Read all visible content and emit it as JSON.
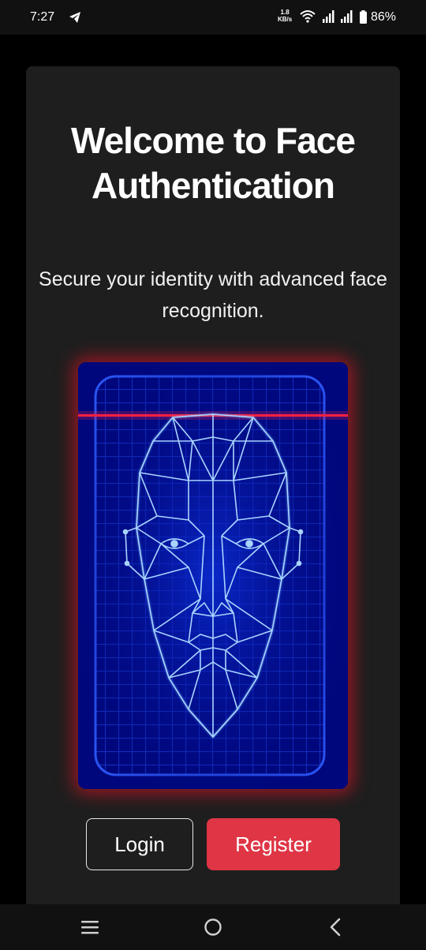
{
  "status_bar": {
    "time": "7:27",
    "speed_value": "1.8",
    "speed_unit": "KB/s",
    "battery": "86%",
    "icons": [
      "telegram-icon",
      "wifi-icon",
      "signal-icon",
      "signal-icon",
      "battery-icon"
    ]
  },
  "main": {
    "title": "Welcome to Face Authentication",
    "subtitle": "Secure your identity with advanced face recognition."
  },
  "buttons": {
    "login": "Login",
    "register": "Register"
  },
  "nav_bar": {
    "icons": [
      "menu-icon",
      "home-icon",
      "back-icon"
    ]
  },
  "colors": {
    "background": "#000000",
    "card": "#1e1e1e",
    "accent_red": "#df3545",
    "illustration_blue": "#00088a",
    "scan_line": "#ff2040",
    "face_lines": "#7ab8ff"
  }
}
